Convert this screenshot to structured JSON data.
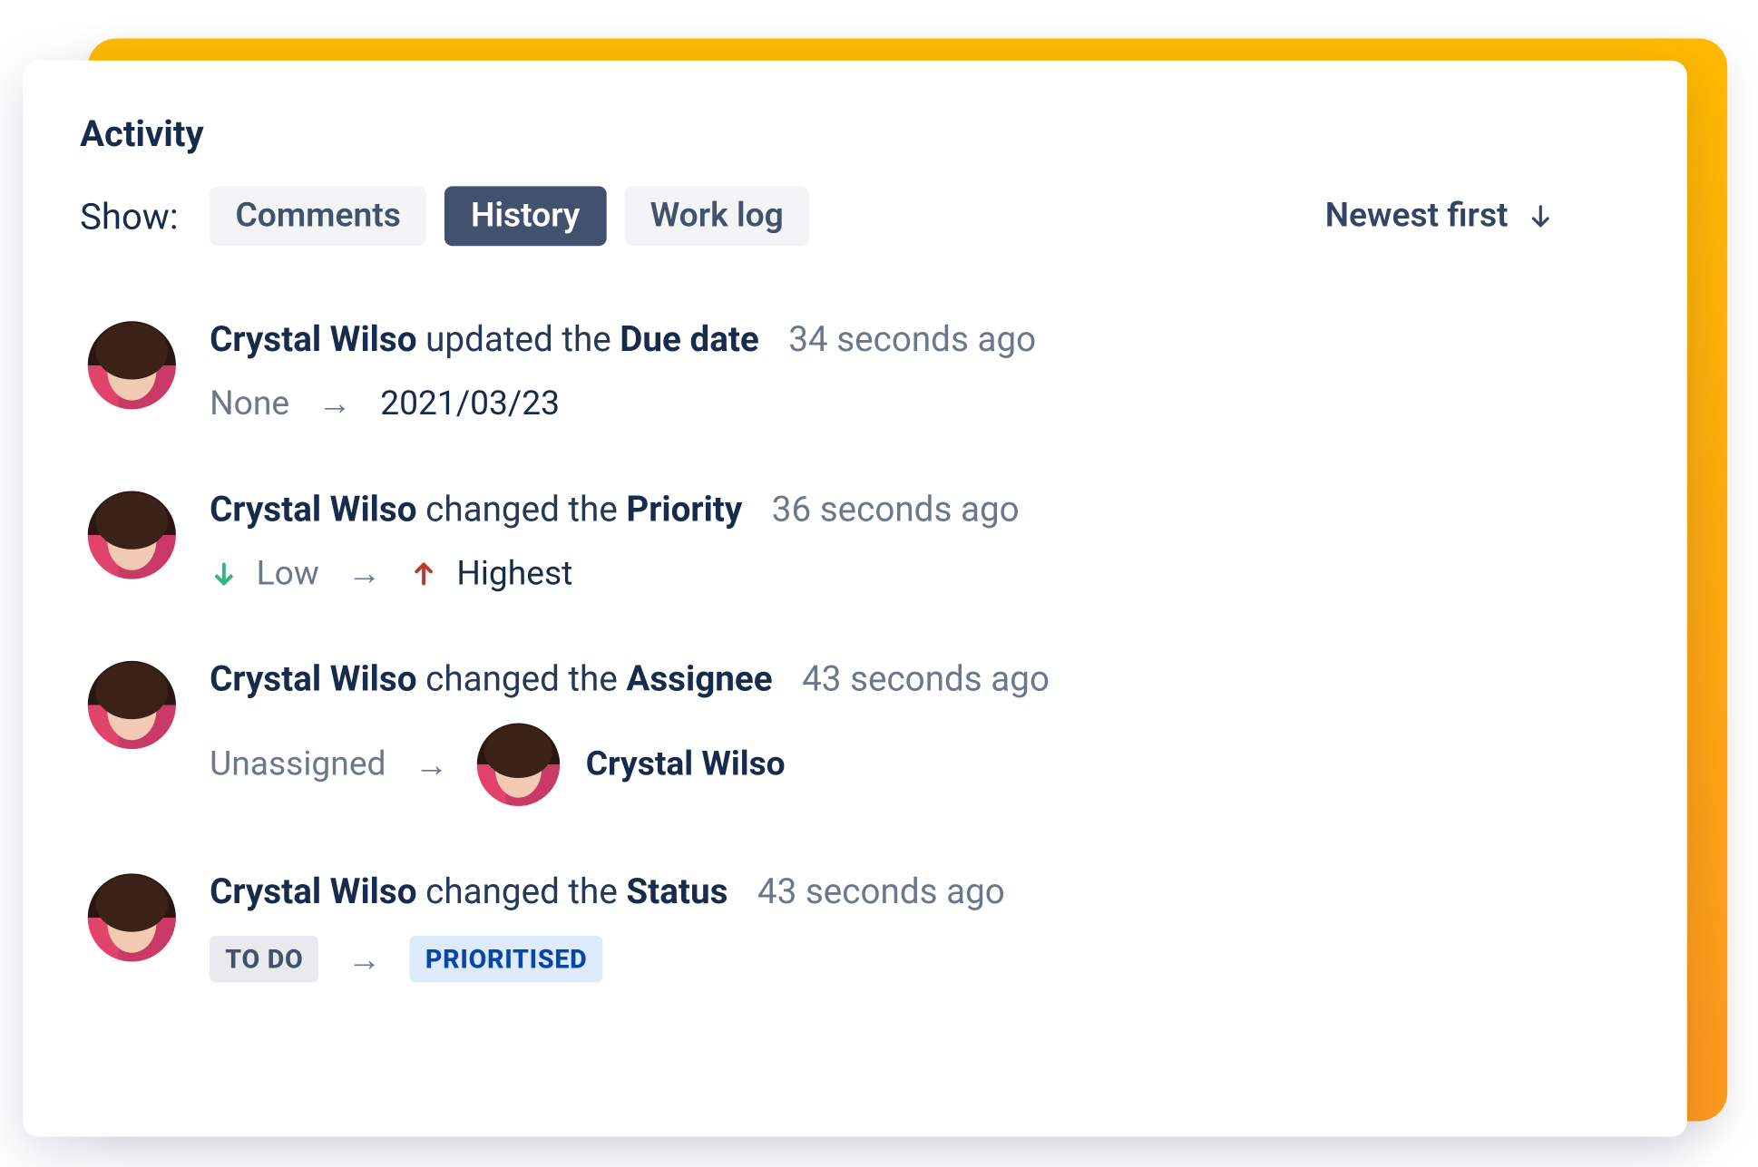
{
  "title": "Activity",
  "show_label": "Show:",
  "tabs": {
    "comments": "Comments",
    "history": "History",
    "worklog": "Work log",
    "active": "history"
  },
  "sort_label": "Newest first",
  "entries": [
    {
      "user": "Crystal Wilso",
      "verb": "updated the",
      "field": "Due date",
      "time": "34 seconds ago",
      "from": "None",
      "to": "2021/03/23"
    },
    {
      "user": "Crystal Wilso",
      "verb": "changed the",
      "field": "Priority",
      "time": "36 seconds ago",
      "from": "Low",
      "to": "Highest"
    },
    {
      "user": "Crystal Wilso",
      "verb": "changed the",
      "field": "Assignee",
      "time": "43 seconds ago",
      "from": "Unassigned",
      "to": "Crystal Wilso"
    },
    {
      "user": "Crystal Wilso",
      "verb": "changed the",
      "field": "Status",
      "time": "43 seconds ago",
      "from": "TO DO",
      "to": "PRIORITISED"
    }
  ]
}
